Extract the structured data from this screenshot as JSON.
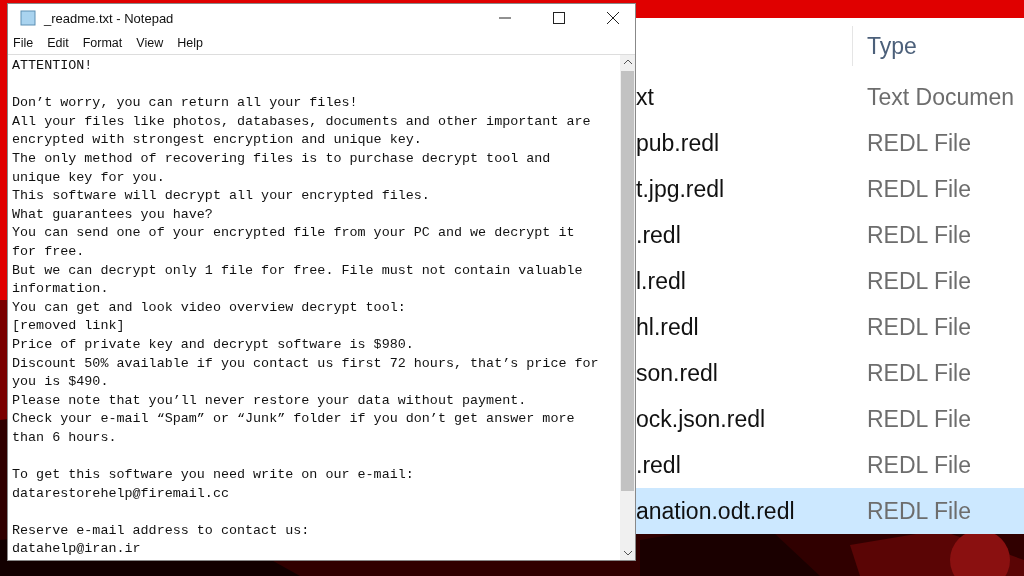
{
  "notepad": {
    "title": "_readme.txt - Notepad",
    "menu": [
      "File",
      "Edit",
      "Format",
      "View",
      "Help"
    ],
    "paragraphs": [
      {
        "lines": [
          "ATTENTION!"
        ]
      },
      {
        "lines": [
          "Don’t worry, you can return all your files!",
          "All your files like photos, databases, documents and other important are",
          "encrypted with strongest encryption and unique key.",
          "The only method of recovering files is to purchase decrypt tool and",
          "unique key for you.",
          "This software will decrypt all your encrypted files.",
          "What guarantees you have?",
          "You can send one of your encrypted file from your PC and we decrypt it",
          "for free.",
          "But we can decrypt only 1 file for free. File must not contain valuable",
          "information.",
          "You can get and look video overview decrypt tool:",
          "[removed link]",
          "Price of private key and decrypt software is $980.",
          "Discount 50% available if you contact us first 72 hours, that’s price for",
          "you is $490.",
          "Please note that you’ll never restore your data without payment.",
          "Check your e-mail “Spam” or “Junk” folder if you don’t get answer more",
          "than 6 hours."
        ]
      },
      {
        "lines": [
          "To get this software you need write on our e-mail:",
          "datarestorehelp@firemail.cc"
        ]
      },
      {
        "lines": [
          "Reserve e-mail address to contact us:",
          "datahelp@iran.ir"
        ]
      }
    ]
  },
  "explorer": {
    "type_header": "Type",
    "rows": [
      {
        "name": "xt",
        "type": "Text Documen",
        "selected": false
      },
      {
        "name": "pub.redl",
        "type": "REDL File",
        "selected": false
      },
      {
        "name": "t.jpg.redl",
        "type": "REDL File",
        "selected": false
      },
      {
        "name": ".redl",
        "type": "REDL File",
        "selected": false
      },
      {
        "name": "l.redl",
        "type": "REDL File",
        "selected": false
      },
      {
        "name": "hl.redl",
        "type": "REDL File",
        "selected": false
      },
      {
        "name": "son.redl",
        "type": "REDL File",
        "selected": false
      },
      {
        "name": "ock.json.redl",
        "type": "REDL File",
        "selected": false
      },
      {
        "name": ".redl",
        "type": "REDL File",
        "selected": false
      },
      {
        "name": "anation.odt.redl",
        "type": "REDL File",
        "selected": true
      }
    ]
  }
}
